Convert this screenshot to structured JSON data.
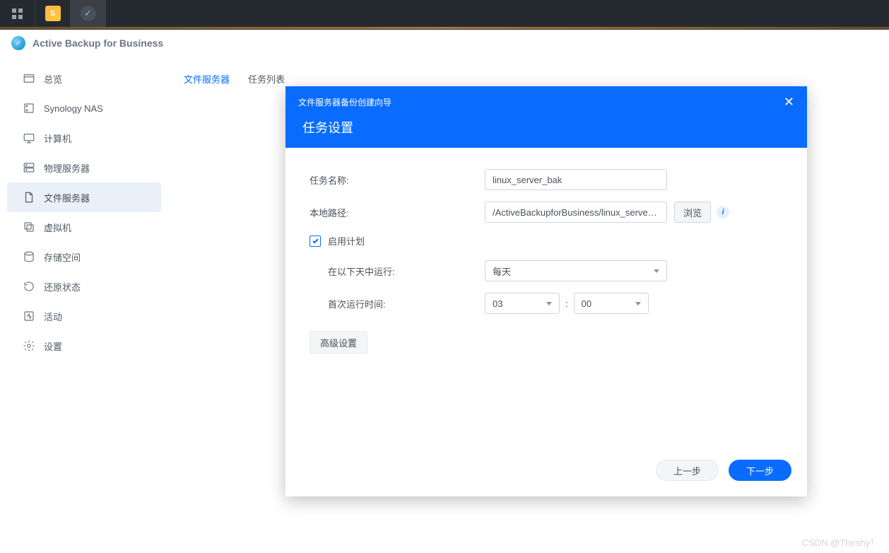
{
  "app_title": "Active Backup for Business",
  "sidebar": {
    "items": [
      {
        "label": "总览"
      },
      {
        "label": "Synology NAS"
      },
      {
        "label": "计算机"
      },
      {
        "label": "物理服务器"
      },
      {
        "label": "文件服务器"
      },
      {
        "label": "虚拟机"
      },
      {
        "label": "存储空间"
      },
      {
        "label": "还原状态"
      },
      {
        "label": "活动"
      },
      {
        "label": "设置"
      }
    ]
  },
  "tabs": {
    "items": [
      {
        "label": "文件服务器"
      },
      {
        "label": "任务列表"
      }
    ]
  },
  "modal": {
    "breadcrumb": "文件服务器备份创建向导",
    "title": "任务设置",
    "close": "✕",
    "task_name_label": "任务名称:",
    "task_name_value": "linux_server_bak",
    "local_path_label": "本地路径:",
    "local_path_value": "/ActiveBackupforBusiness/linux_server_bak",
    "browse": "浏览",
    "enable_schedule": "启用计划",
    "run_days_label": "在以下天中运行:",
    "run_days_value": "每天",
    "first_run_label": "首次运行时间:",
    "hour": "03",
    "minute": "00",
    "advanced": "高级设置",
    "prev": "上一步",
    "next": "下一步"
  },
  "watermark": "CSDN @Theshy！"
}
